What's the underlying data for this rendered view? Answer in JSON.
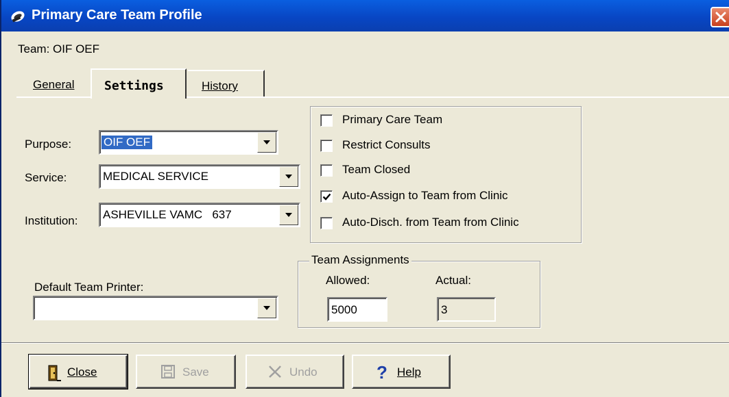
{
  "window": {
    "title": "Primary Care Team Profile",
    "title_icon": "team-profile-icon",
    "close_icon": "close-icon",
    "accent_color": "#0a46c4"
  },
  "team_label": "Team: OIF OEF",
  "tabs": [
    {
      "label": "General",
      "active": false
    },
    {
      "label": "Settings",
      "active": true
    },
    {
      "label": "History",
      "active": false
    }
  ],
  "fields": {
    "purpose": {
      "label": "Purpose:",
      "value": "OIF OEF"
    },
    "service": {
      "label": "Service:",
      "value": "MEDICAL SERVICE"
    },
    "institution": {
      "label": "Institution:",
      "value": "ASHEVILLE VAMC   637"
    },
    "default_printer": {
      "label": "Default Team Printer:",
      "value": ""
    }
  },
  "options": [
    {
      "label": "Primary Care Team",
      "checked": false
    },
    {
      "label": "Restrict Consults",
      "checked": false
    },
    {
      "label": "Team Closed",
      "checked": false
    },
    {
      "label": "Auto-Assign to Team from Clinic",
      "checked": true
    },
    {
      "label": "Auto-Disch. from Team from Clinic",
      "checked": false
    }
  ],
  "assignments": {
    "title": "Team Assignments",
    "allowed_label": "Allowed:",
    "allowed_value": "5000",
    "actual_label": "Actual:",
    "actual_value": "3"
  },
  "buttons": {
    "close": {
      "label": "Close",
      "icon": "door-exit-icon",
      "enabled": true
    },
    "save": {
      "label": "Save",
      "icon": "floppy-disk-icon",
      "enabled": false
    },
    "undo": {
      "label": "Undo",
      "icon": "undo-x-icon",
      "enabled": false
    },
    "help": {
      "label": "Help",
      "icon": "question-mark-icon",
      "enabled": true
    }
  }
}
